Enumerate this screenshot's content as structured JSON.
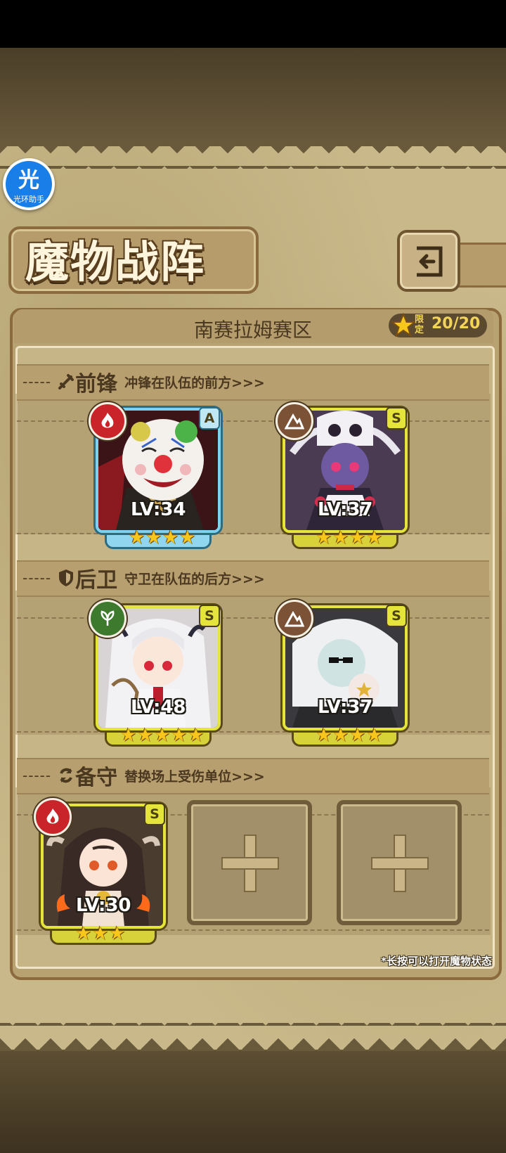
{
  "assistant": {
    "glyph": "光",
    "label": "光环助手"
  },
  "title": "魔物战阵",
  "region": {
    "name": "南赛拉姆赛区",
    "limit_label": "限定",
    "limit_value": "20/20"
  },
  "sections": {
    "front": {
      "title": "前锋",
      "subtitle": "冲锋在队伍的前方>>>",
      "icon": "sword-icon"
    },
    "rear": {
      "title": "后卫",
      "subtitle": "守卫在队伍的后方>>>",
      "icon": "shield-icon"
    },
    "reserve": {
      "title": "备守",
      "subtitle": "替换场上受伤单位>>>",
      "icon": "swap-icon"
    }
  },
  "monsters": [
    {
      "id": "clown",
      "grade": "A",
      "element": "fire",
      "level": "LV:34",
      "stars": 4,
      "frame": "blue"
    },
    {
      "id": "skull-girl",
      "grade": "S",
      "element": "earth",
      "level": "LV:37",
      "stars": 4,
      "frame": "gold"
    },
    {
      "id": "white-hair-girl",
      "grade": "S",
      "element": "wood",
      "level": "LV:48",
      "stars": 5,
      "frame": "gold"
    },
    {
      "id": "pale-ghost",
      "grade": "S",
      "element": "earth",
      "level": "LV:37",
      "stars": 4,
      "frame": "gold"
    },
    {
      "id": "horned-girl",
      "grade": "S",
      "element": "fire",
      "level": "LV:30",
      "stars": 3,
      "frame": "gold"
    }
  ],
  "hint": "*长按可以打开魔物状态",
  "colors": {
    "gold_frame": "#e5e43a",
    "blue_frame": "#7fd2ef",
    "star": "#f7c81b",
    "fire": "#c9242a",
    "earth": "#7b5236",
    "wood": "#3e7a2e"
  }
}
